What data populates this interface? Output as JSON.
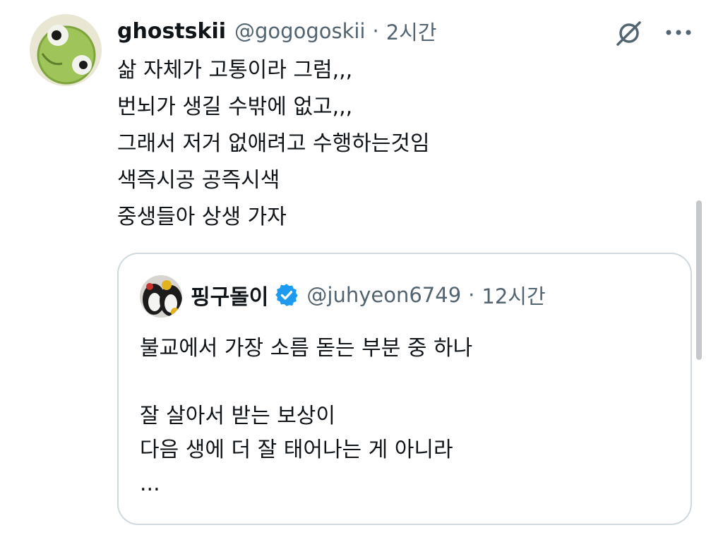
{
  "tweet": {
    "display_name": "ghostskii",
    "handle": "@gogogoskii",
    "separator": "·",
    "time": "2시간",
    "lines": [
      "삶 자체가 고통이라 그럼,,,",
      "번뇌가 생길 수밖에 없고,,,",
      "그래서 저거 없애려고 수행하는것임",
      "색즉시공 공즉시색",
      "중생들아 상생 가자"
    ],
    "icons": {
      "avatar": "frog-avatar",
      "grok": "grok-icon",
      "more": "more-icon"
    }
  },
  "quote": {
    "display_name": "핑구돌이",
    "handle": "@juhyeon6749",
    "separator": "·",
    "time": "12시간",
    "lines": [
      "불교에서 가장 소름 돋는 부분 중 하나",
      "",
      "잘 살아서 받는 보상이",
      "다음 생에 더 잘 태어나는 게 아니라",
      "..."
    ],
    "icons": {
      "avatar": "penguin-avatar",
      "verified": "verified-badge-icon"
    }
  },
  "colors": {
    "text_primary": "#0f1419",
    "text_secondary": "#536471",
    "border": "#cfd9de",
    "verified_blue": "#1d9bf0"
  }
}
